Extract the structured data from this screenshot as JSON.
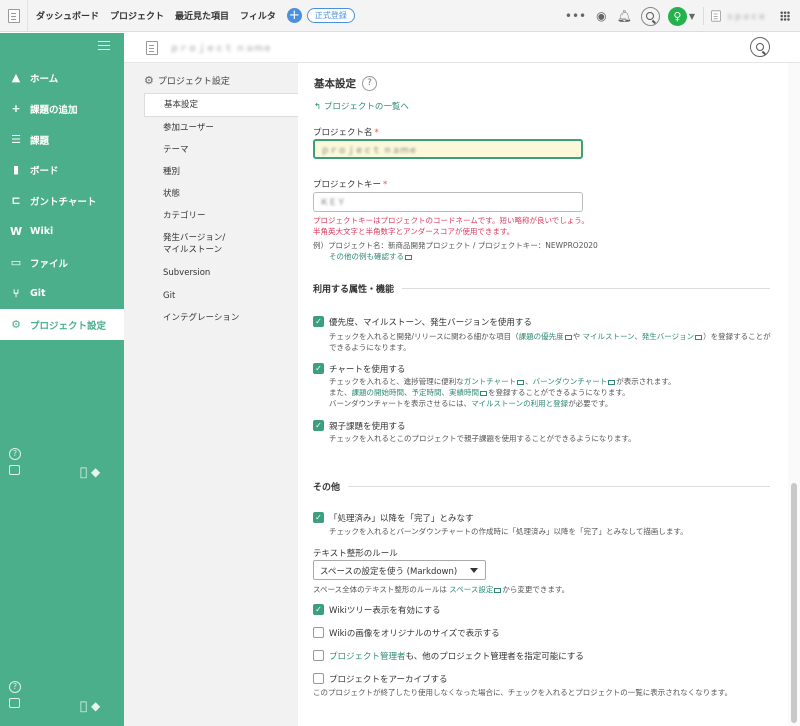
{
  "topbar": {
    "nav": [
      "ダッシュボード",
      "プロジェクト",
      "最近見た項目",
      "フィルタ"
    ],
    "plus": "+",
    "badge": "正式登録",
    "dots": "•••",
    "avatar_letter": "♀",
    "space_name": "ｓｐａｃｅ"
  },
  "sidebar": {
    "items": [
      {
        "icon": "▲",
        "label": "ホーム"
      },
      {
        "icon": "+",
        "label": "課題の追加"
      },
      {
        "icon": "☰",
        "label": "課題"
      },
      {
        "icon": "▮",
        "label": "ボード"
      },
      {
        "icon": "⊏",
        "label": "ガントチャート"
      },
      {
        "icon": "W",
        "label": "Wiki"
      },
      {
        "icon": "▭",
        "label": "ファイル"
      },
      {
        "icon": "⑂",
        "label": "Git"
      },
      {
        "icon": "⚙",
        "label": "プロジェクト設定"
      }
    ],
    "help": "?"
  },
  "project": {
    "name": "ｐｒｏｊｅｃｔ ｎａｍｅ"
  },
  "settings_nav": {
    "header": "プロジェクト設定",
    "items": [
      "基本設定",
      "参加ユーザー",
      "テーマ",
      "種別",
      "状態",
      "カテゴリー",
      "発生バージョン/\nマイルストーン",
      "Subversion",
      "Git",
      "インテグレーション"
    ]
  },
  "main": {
    "title": "基本設定",
    "help": "?",
    "back_link": "プロジェクトの一覧へ",
    "project_name_label": "プロジェクト名",
    "project_name_value": "ｐｒｏｊｅｃｔ ｎａｍｅ",
    "project_key_label": "プロジェクトキー",
    "project_key_value": "ＫＥＹ",
    "key_error_1": "プロジェクトキーはプロジェクトのコードネームです。短い略称が良いでしょう。",
    "key_error_2": "半角英大文字と半角数字とアンダースコアが使用できます。",
    "key_example": "例）プロジェクト名：新商品開発プロジェクト / プロジェクトキー：NEWPRO2020",
    "more_examples": "その他の例も確認する",
    "section_features": "利用する属性・機能",
    "opt_priority": "優先度、マイルストーン、発生バージョンを使用する",
    "opt_priority_desc_a": "チェックを入れると開発/リリースに関わる細かな項目（",
    "opt_priority_link1": "課題の優先度",
    "opt_priority_desc_b": "や",
    "opt_priority_link2": "マイルストーン",
    "opt_priority_link3": "発生バージョン",
    "opt_priority_desc_c": "）を登録することが",
    "opt_priority_desc_d": "できるようになります。",
    "opt_chart": "チャートを使用する",
    "opt_chart_desc_a": "チェックを入れると、進捗管理に便利な",
    "opt_chart_link1": "ガントチャート",
    "opt_chart_link2": "バーンダウンチャート",
    "opt_chart_desc_b": "が表示されます。",
    "opt_chart_desc_c": "また、",
    "opt_chart_link3": "課題の開始時間",
    "opt_chart_link4": "予定時間",
    "opt_chart_link5": "実績時間",
    "opt_chart_desc_d": "を登録することができるようになります。",
    "opt_chart_desc_e": "バーンダウンチャートを表示させるには、",
    "opt_chart_link6": "マイルストーンの利用と登録",
    "opt_chart_desc_f": "が必要です。",
    "opt_parent": "親子課題を使用する",
    "opt_parent_desc": "チェックを入れるとこのプロジェクトで親子課題を使用することができるようになります。",
    "section_other": "その他",
    "opt_done": "「処理済み」以降を「完了」とみなす",
    "opt_done_desc": "チェックを入れるとバーンダウンチャートの作成時に「処理済み」以降を「完了」とみなして描画します。",
    "format_label": "テキスト整形のルール",
    "format_select": "スペースの設定を使う (Markdown)",
    "format_note_a": "スペース全体のテキスト整形のルールは",
    "format_note_link": "スペース設定",
    "format_note_b": "から変更できます。",
    "opt_wiki_tree": "Wikiツリー表示を有効にする",
    "opt_wiki_image": "Wikiの画像をオリジナルのサイズで表示する",
    "opt_admin_link": "プロジェクト管理者",
    "opt_admin_rest": "も、他のプロジェクト管理者を指定可能にする",
    "opt_archive": "プロジェクトをアーカイブする",
    "opt_archive_desc": "このプロジェクトが終了したり使用しなくなった場合に、チェックを入れるとプロジェクトの一覧に表示されなくなります。",
    "check": "✓"
  },
  "colors": {
    "sidebar": "#4caf8c",
    "link": "#2e8a76",
    "error": "#e0395d",
    "checkbox": "#3d9f7f"
  }
}
